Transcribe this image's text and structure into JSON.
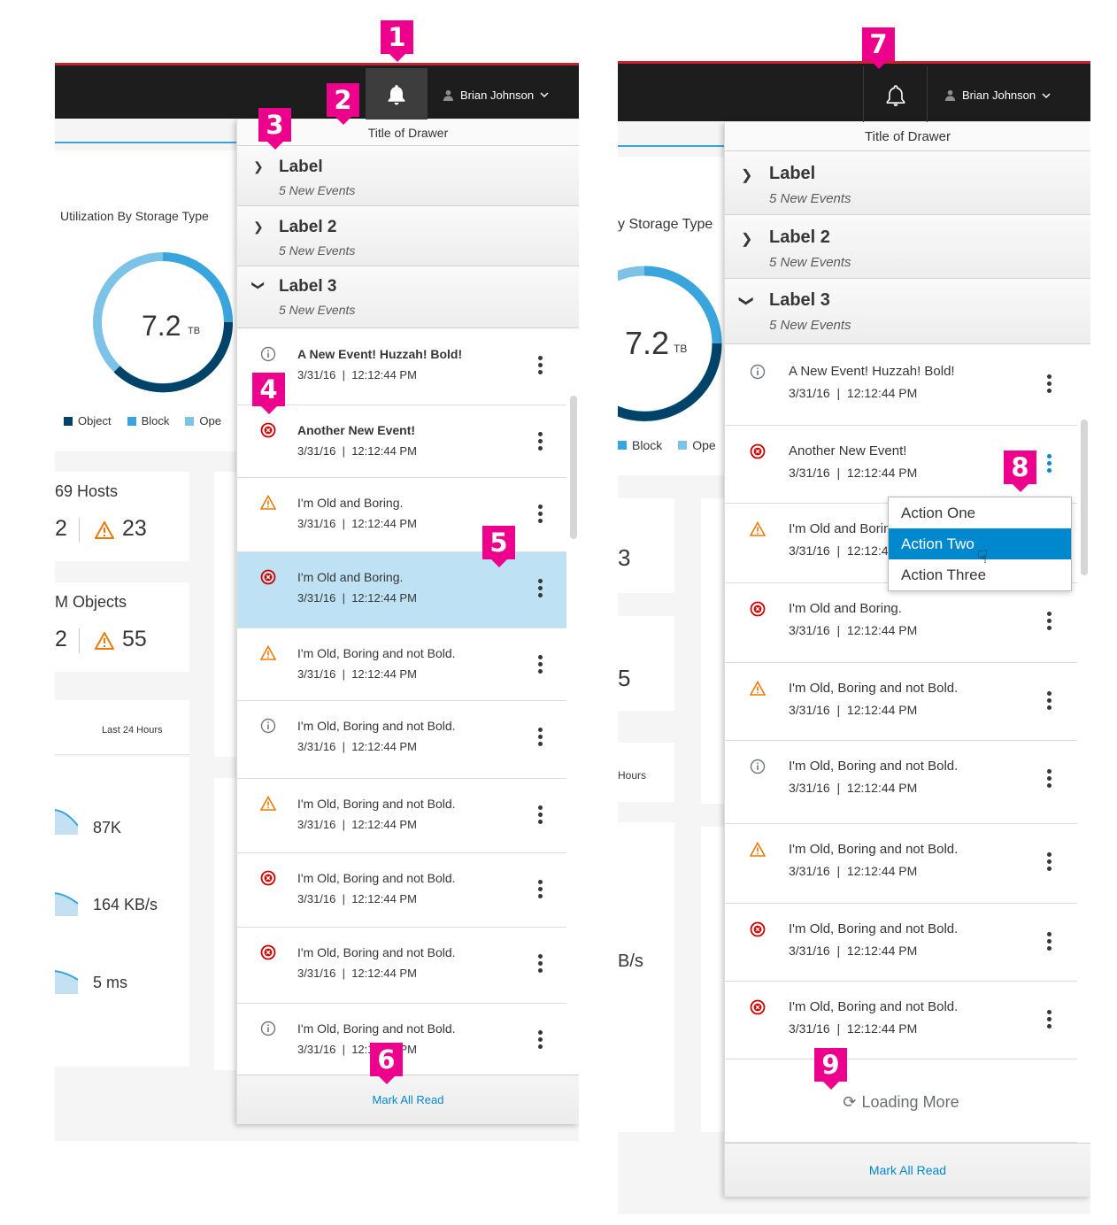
{
  "user_name": "Brian Johnson",
  "drawer_title": "Title of Drawer",
  "groups": [
    {
      "label": "Label",
      "sub": "5 New Events"
    },
    {
      "label": "Label 2",
      "sub": "5 New Events"
    },
    {
      "label": "Label 3",
      "sub": "5 New Events"
    }
  ],
  "left_events": [
    {
      "icon": "info",
      "msg": "A New Event! Huzzah! Bold!",
      "bold": true,
      "ts": "3/31/16  |  12:12:44 PM"
    },
    {
      "icon": "error",
      "msg": "Another New Event!",
      "bold": true,
      "ts": "3/31/16  |  12:12:44 PM"
    },
    {
      "icon": "warning",
      "msg": "I'm Old and Boring.",
      "bold": false,
      "ts": "3/31/16  |  12:12:44 PM"
    },
    {
      "icon": "error",
      "msg": "I'm Old and Boring.",
      "bold": false,
      "ts": "3/31/16  |  12:12:44 PM",
      "selected": true
    },
    {
      "icon": "warning",
      "msg": "I'm Old, Boring and not Bold.",
      "bold": false,
      "ts": "3/31/16  |  12:12:44 PM"
    },
    {
      "icon": "info",
      "msg": "I'm Old, Boring and not Bold.",
      "bold": false,
      "ts": "3/31/16  |  12:12:44 PM"
    },
    {
      "icon": "warning",
      "msg": "I'm Old, Boring and not Bold.",
      "bold": false,
      "ts": "3/31/16  |  12:12:44 PM"
    },
    {
      "icon": "error",
      "msg": "I'm Old, Boring and not Bold.",
      "bold": false,
      "ts": "3/31/16  |  12:12:44 PM"
    },
    {
      "icon": "error",
      "msg": "I'm Old, Boring and not Bold.",
      "bold": false,
      "ts": "3/31/16  |  12:12:44 PM"
    },
    {
      "icon": "info",
      "msg": "I'm Old, Boring and not Bold.",
      "bold": false,
      "ts": "3/31/16  |  12:12:44 PM"
    }
  ],
  "right_events": [
    {
      "icon": "info",
      "msg": "A New Event! Huzzah! Bold!",
      "ts": "3/31/16  |  12:12:44 PM"
    },
    {
      "icon": "error",
      "msg": "Another New Event!",
      "ts": "3/31/16  |  12:12:44 PM",
      "kebab_active": true
    },
    {
      "icon": "warning",
      "msg": "I'm Old and Boring.",
      "ts": "3/31/16  |  12:12:44 PM"
    },
    {
      "icon": "error",
      "msg": "I'm Old and Boring.",
      "ts": "3/31/16  |  12:12:44 PM"
    },
    {
      "icon": "warning",
      "msg": "I'm Old, Boring and not Bold.",
      "ts": "3/31/16  |  12:12:44 PM"
    },
    {
      "icon": "info",
      "msg": "I'm Old, Boring and not Bold.",
      "ts": "3/31/16  |  12:12:44 PM"
    },
    {
      "icon": "warning",
      "msg": "I'm Old, Boring and not Bold.",
      "ts": "3/31/16  |  12:12:44 PM"
    },
    {
      "icon": "error",
      "msg": "I'm Old, Boring and not Bold.",
      "ts": "3/31/16  |  12:12:44 PM"
    },
    {
      "icon": "error",
      "msg": "I'm Old, Boring and not Bold.",
      "ts": "3/31/16  |  12:12:44 PM"
    }
  ],
  "action_menu": [
    "Action One",
    "Action Two",
    "Action Three"
  ],
  "action_menu_active": "Action Two",
  "mark_all_read": "Mark All Read",
  "loading_more": "Loading More",
  "background": {
    "utilization_title": "Utilization By Storage Type",
    "utilization_title_cut": "y Storage Type",
    "donut_value": "7.2",
    "donut_unit": "TB",
    "legend": [
      "Object",
      "Block",
      "Ope"
    ],
    "hosts_title": "69 Hosts",
    "hosts_left": "2",
    "hosts_warn": "23",
    "objects_title": "M Objects",
    "objects_left": "2",
    "objects_warn": "55",
    "r_val1": "3",
    "r_val2": "5",
    "last24": "Last 24 Hours",
    "last24_cut": "Hours",
    "metric1": "87K",
    "metric2": "164 KB/s",
    "metric3": "5 ms",
    "metric2_cut": "B/s"
  },
  "badges": [
    "1",
    "2",
    "3",
    "4",
    "5",
    "6",
    "7",
    "8",
    "9"
  ],
  "colors": {
    "brand_red": "#c8202e",
    "accent_blue": "#0088ce",
    "badge_pink": "#ec008c",
    "selected_row": "#bee1f4",
    "error": "#cc0000",
    "warning": "#ec7a08"
  }
}
